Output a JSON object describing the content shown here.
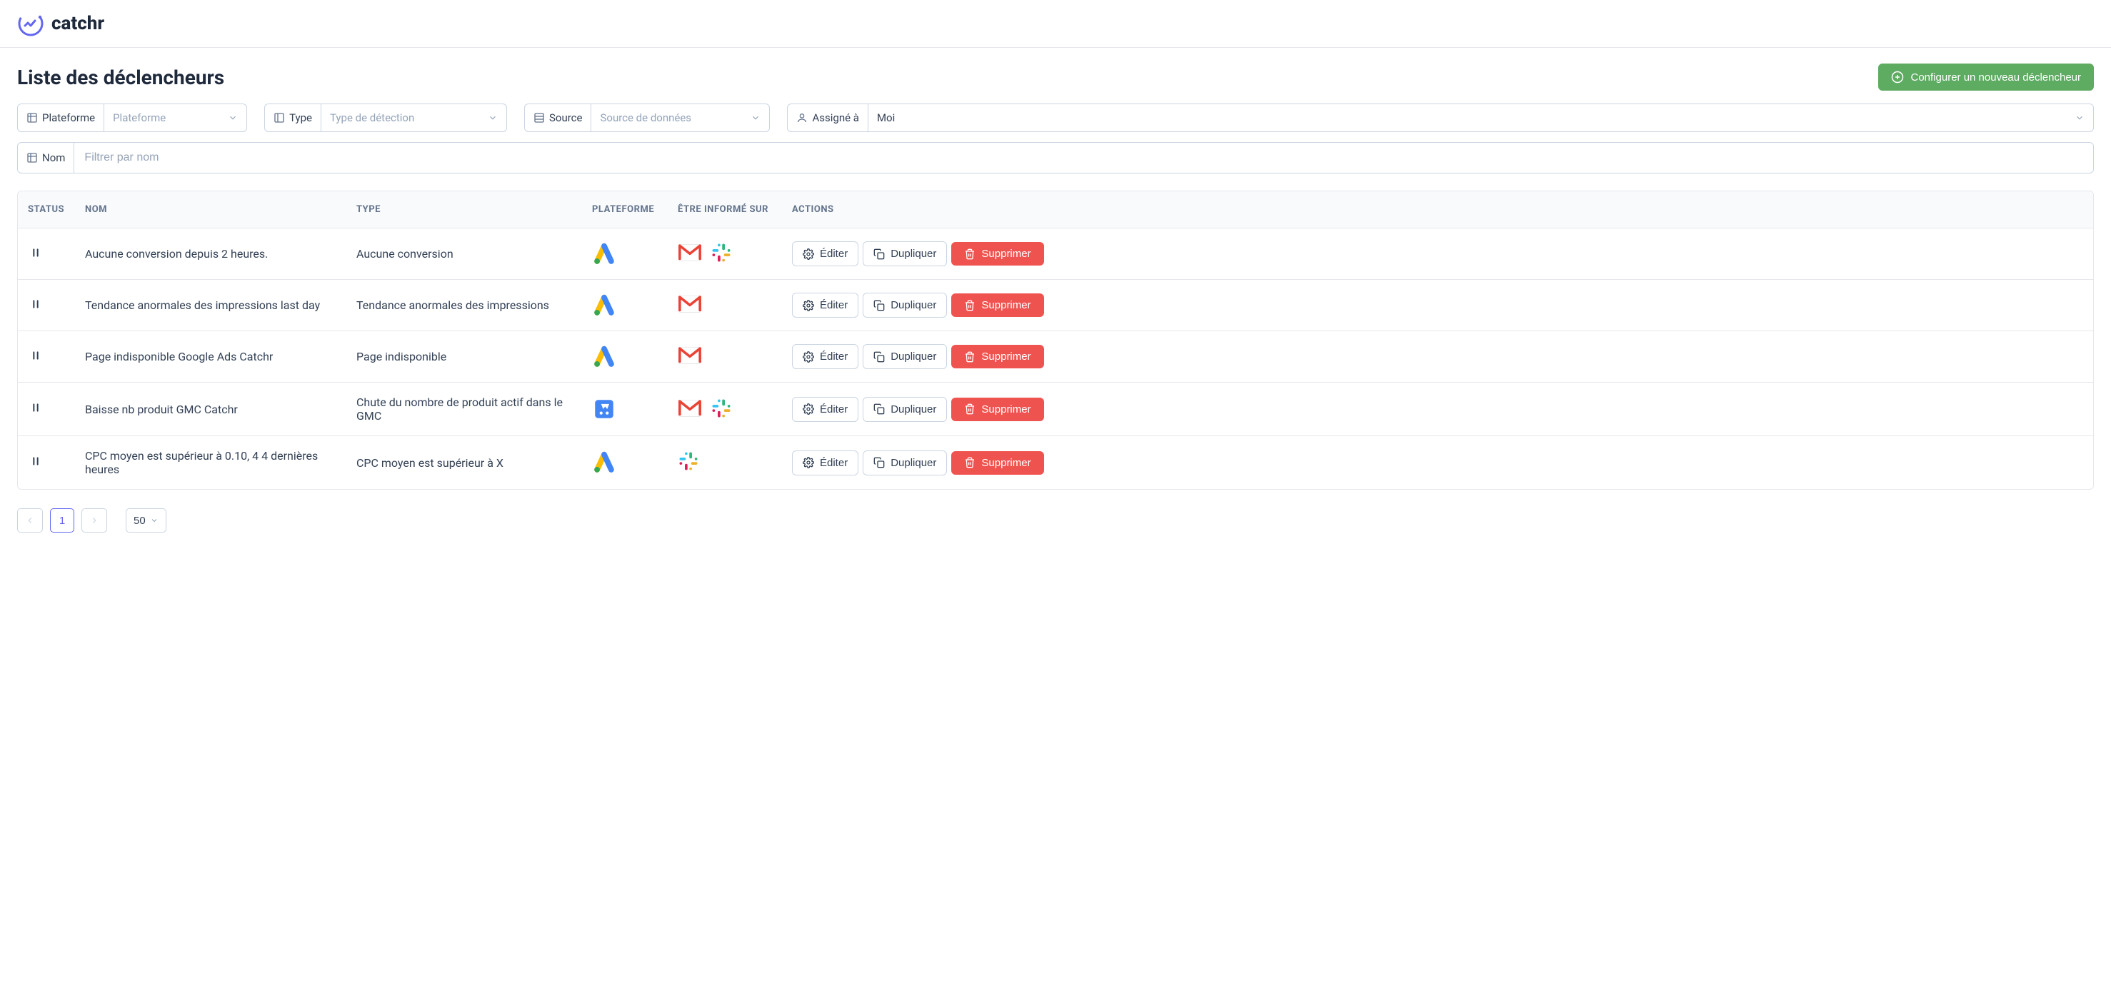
{
  "logo_text": "catchr",
  "page_title": "Liste des déclencheurs",
  "configure_button": "Configurer un nouveau déclencheur",
  "filters": {
    "platform_label": "Plateforme",
    "platform_placeholder": "Plateforme",
    "type_label": "Type",
    "type_placeholder": "Type de détection",
    "source_label": "Source",
    "source_placeholder": "Source de données",
    "assigned_label": "Assigné à",
    "assigned_value": "Moi",
    "name_label": "Nom",
    "name_placeholder": "Filtrer par nom"
  },
  "table": {
    "headers": {
      "status": "STATUS",
      "name": "NOM",
      "type": "TYPE",
      "platform": "PLATEFORME",
      "informed_on": "ÊTRE INFORMÉ SUR",
      "actions": "ACTIONS"
    },
    "rows": [
      {
        "status": "paused",
        "name": "Aucune conversion depuis 2 heures.",
        "type": "Aucune conversion",
        "platform": "google-ads",
        "informed": [
          "gmail",
          "slack"
        ]
      },
      {
        "status": "paused",
        "name": "Tendance anormales des impressions last day",
        "type": "Tendance anormales des impressions",
        "platform": "google-ads",
        "informed": [
          "gmail"
        ]
      },
      {
        "status": "paused",
        "name": "Page indisponible Google Ads Catchr",
        "type": "Page indisponible",
        "platform": "google-ads",
        "informed": [
          "gmail"
        ]
      },
      {
        "status": "paused",
        "name": "Baisse nb produit GMC Catchr",
        "type": "Chute du nombre de produit actif dans le GMC",
        "platform": "google-merchant",
        "informed": [
          "gmail",
          "slack"
        ]
      },
      {
        "status": "paused",
        "name": "CPC moyen est supérieur à 0.10, 4 4 dernières heures",
        "type": "CPC moyen est supérieur à X",
        "platform": "google-ads",
        "informed": [
          "slack"
        ]
      }
    ]
  },
  "actions": {
    "edit": "Éditer",
    "duplicate": "Dupliquer",
    "delete": "Supprimer"
  },
  "pagination": {
    "current_page": "1",
    "page_size": "50"
  }
}
